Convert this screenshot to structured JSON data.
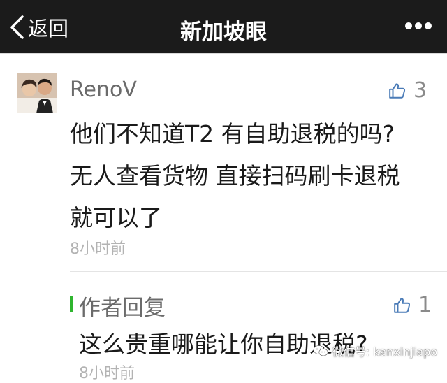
{
  "nav": {
    "back_label": "返回",
    "title": "新加坡眼",
    "back_icon": "chevron-left-icon",
    "more_icon": "more-dots-icon",
    "background": "#1b1b1b"
  },
  "comment": {
    "username": "RenoV",
    "likes": "3",
    "lines": [
      "他们不知道T2 有自助退税的吗?",
      "无人查看货物 直接扫码刷卡退税",
      "就可以了"
    ],
    "time": "8小时前",
    "like_icon": "thumbs-up-icon"
  },
  "reply": {
    "label": "作者回复",
    "likes": "1",
    "text": "这么贵重哪能让你自助退税?",
    "time": "8小时前",
    "accent": "#2fb52f"
  },
  "watermark": {
    "text": "微信号: kanxinjiapo",
    "icon": "wechat-icon"
  }
}
